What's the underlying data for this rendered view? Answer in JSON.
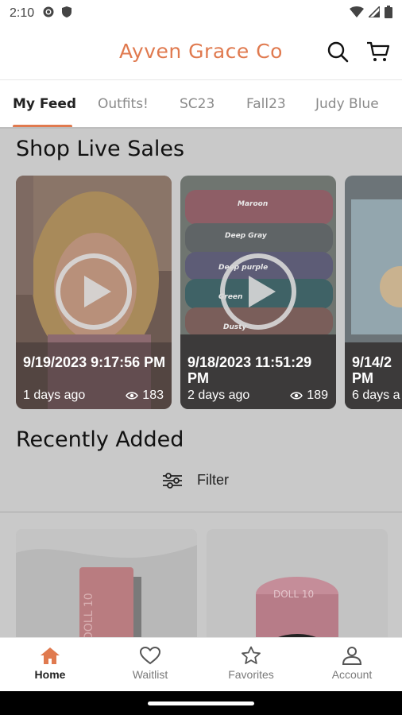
{
  "status_bar": {
    "time": "2:10"
  },
  "header": {
    "title": "Ayven Grace Co",
    "accent": "#e07a4f"
  },
  "tabs": [
    {
      "label": "My Feed",
      "active": true
    },
    {
      "label": "Outfits!"
    },
    {
      "label": "SC23"
    },
    {
      "label": "Fall23"
    },
    {
      "label": "Judy Blue"
    }
  ],
  "live": {
    "title": "Shop Live Sales",
    "videos": [
      {
        "date": "9/19/2023 9:17:56 PM",
        "ago": "1 days ago",
        "views": "183"
      },
      {
        "date": "9/18/2023 11:51:29 PM",
        "ago": "2 days ago",
        "views": "189"
      },
      {
        "date": "9/14/2",
        "date2": "PM",
        "ago": "6 days a"
      }
    ],
    "stack_labels": [
      "Maroon",
      "Deep Gray",
      "Deep purple",
      "Green",
      "Dusty"
    ]
  },
  "recent": {
    "title": "Recently Added",
    "filter_label": "Filter",
    "product_brand": "DOLL 10"
  },
  "nav": [
    {
      "label": "Home",
      "active": true
    },
    {
      "label": "Waitlist"
    },
    {
      "label": "Favorites"
    },
    {
      "label": "Account"
    }
  ]
}
